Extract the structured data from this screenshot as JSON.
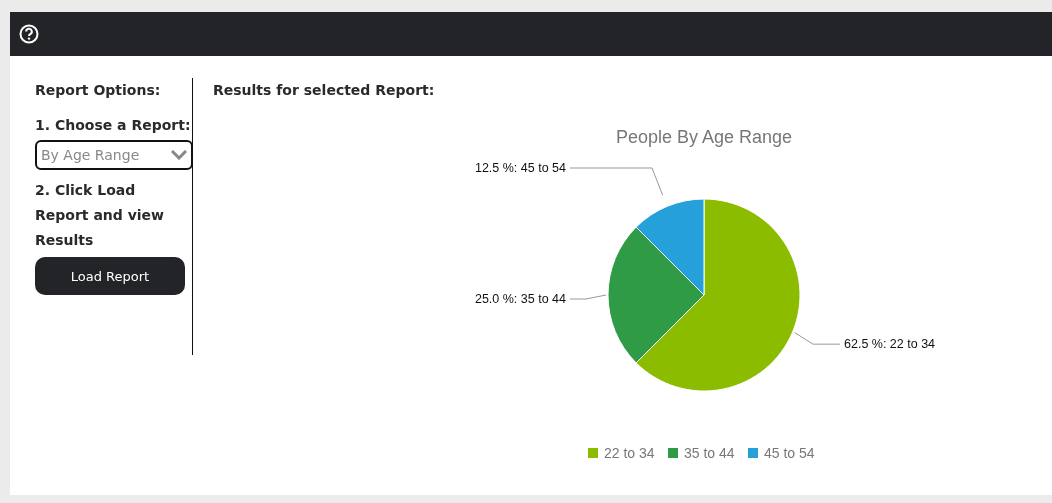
{
  "options": {
    "title": "Report Options:",
    "step1": "1. Choose a Report:",
    "report_select": {
      "value": "By Age Range"
    },
    "step2": "2. Click Load Report and view Results",
    "load_button": "Load Report"
  },
  "results": {
    "title": "Results for selected Report:",
    "chart_data": {
      "type": "pie",
      "title": "People By Age Range",
      "categories": [
        "22 to 34",
        "35 to 44",
        "45 to 54"
      ],
      "values": [
        62.5,
        25.0,
        12.5
      ],
      "legend": "bottom",
      "colors": [
        "#8cbc00",
        "#309b46",
        "#25a0da"
      ],
      "value_labels": [
        "62.5 %: 22 to 34",
        "25.0 %: 35 to 44",
        "12.5 %: 45 to 54"
      ]
    }
  }
}
